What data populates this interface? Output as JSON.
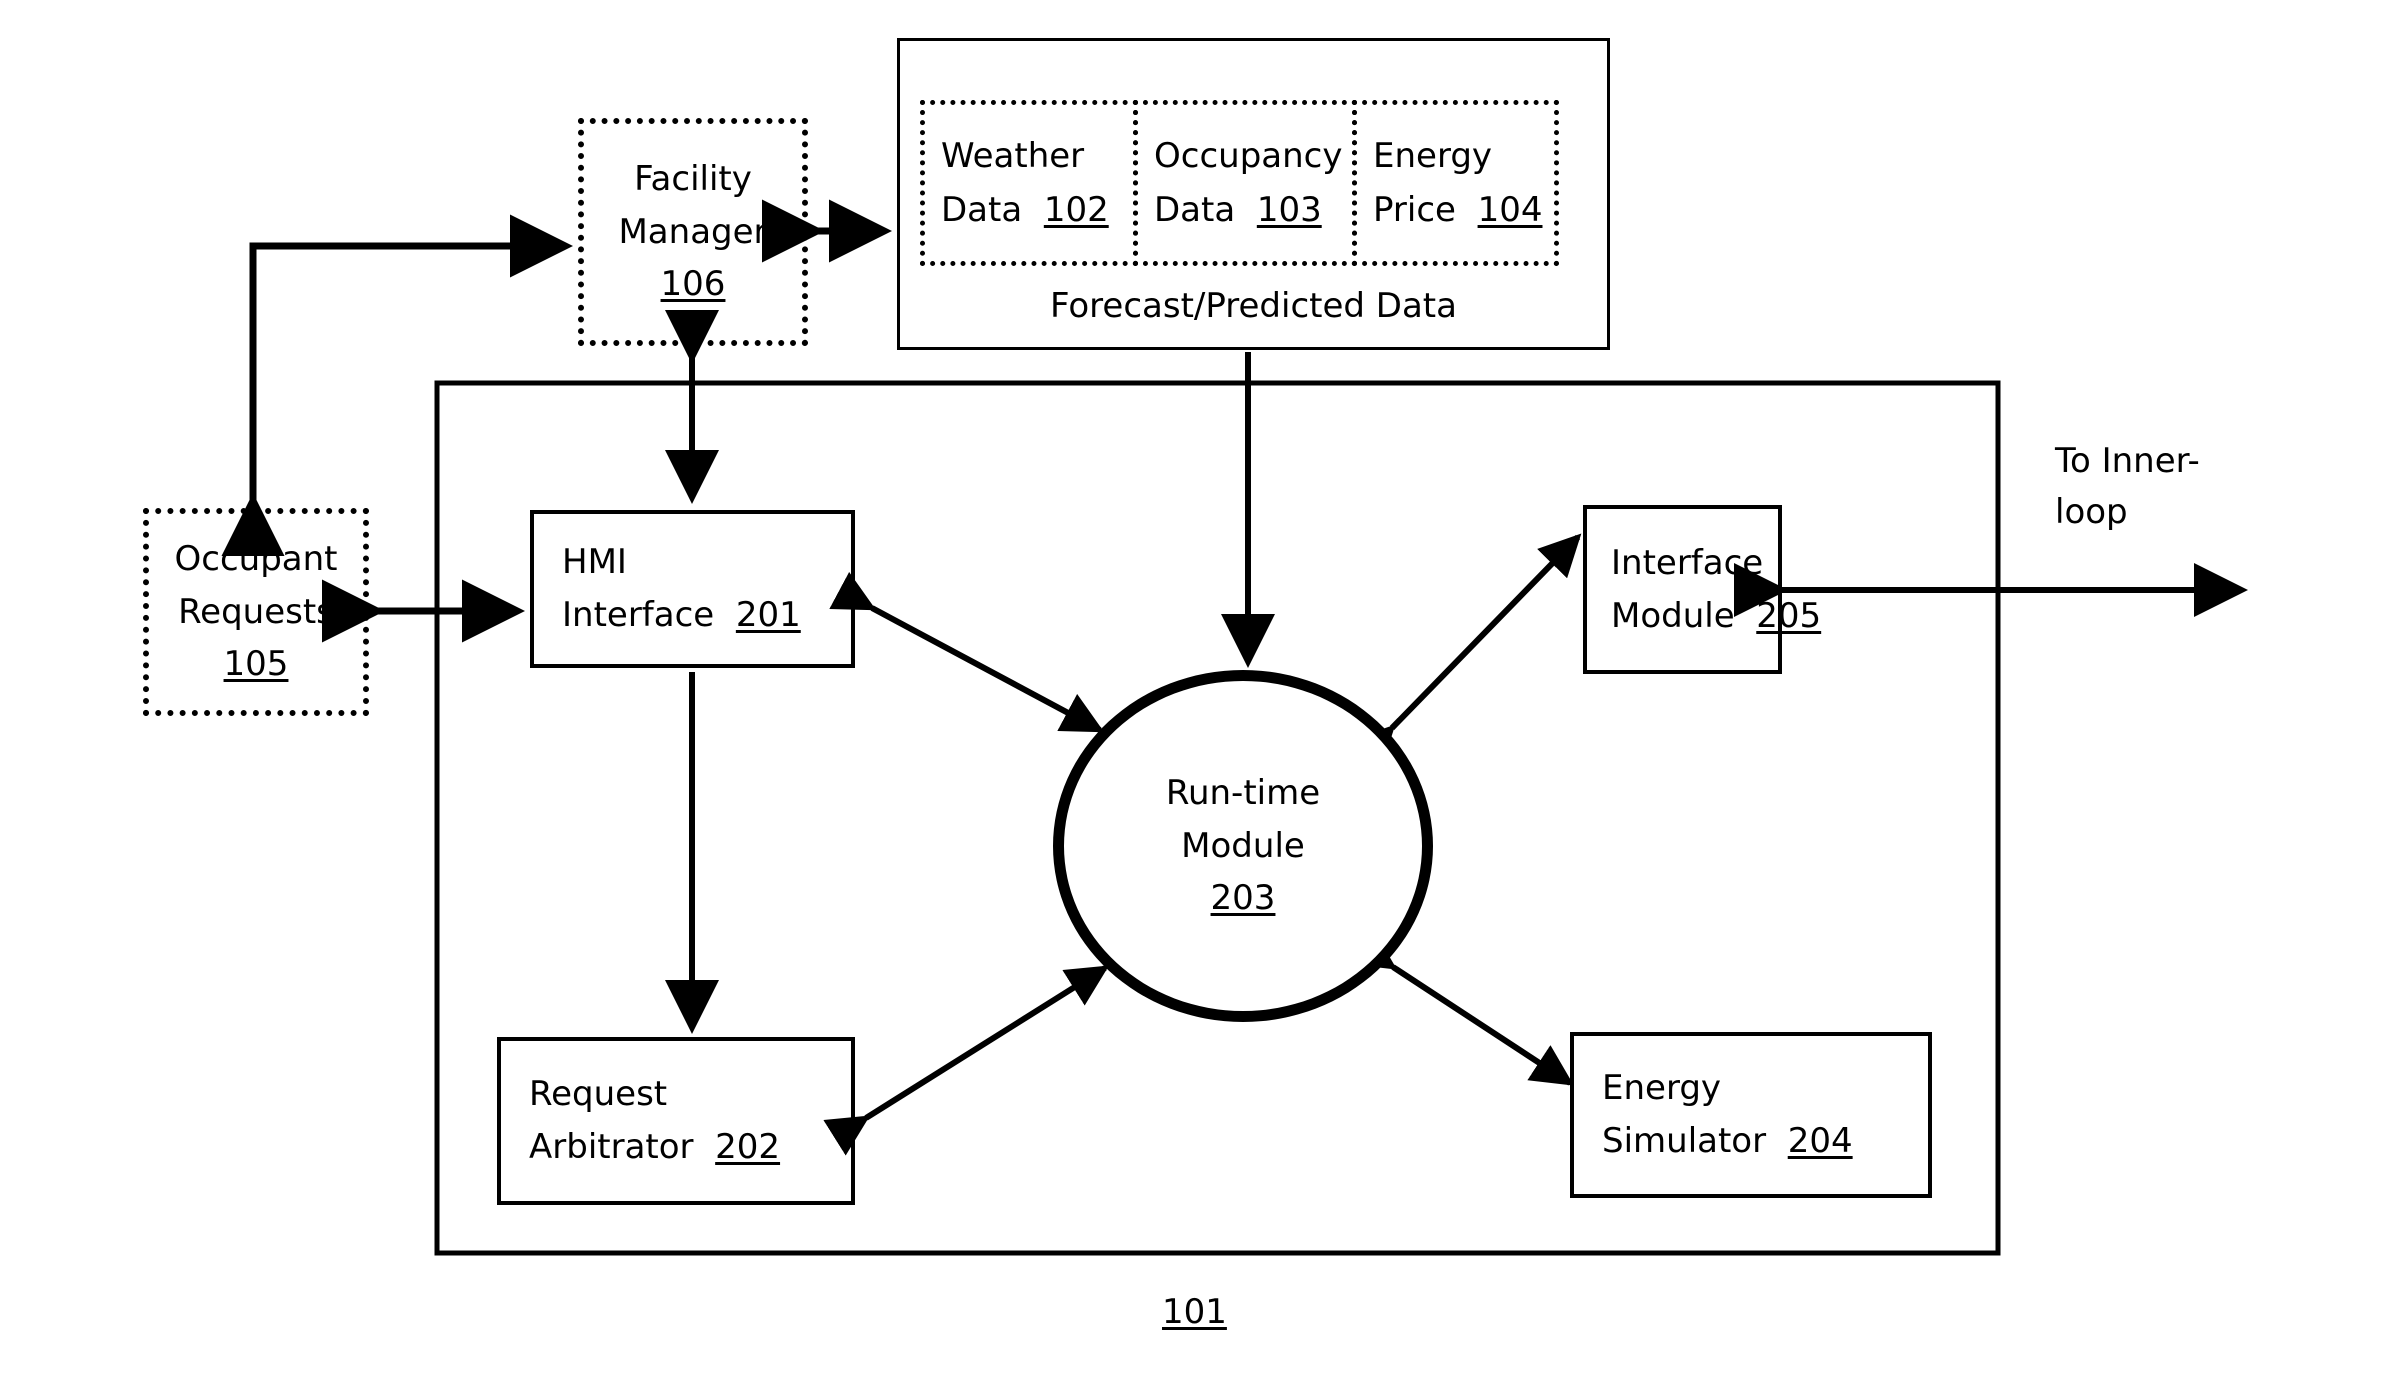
{
  "diagram": {
    "figure_label": "101",
    "outer_container_name": "outer-system-boundary",
    "external_note": "To Inner-loop",
    "forecast_group": {
      "caption": "Forecast/Predicted Data",
      "cells": [
        {
          "line1": "Weather",
          "line2": "Data",
          "ref": "102"
        },
        {
          "line1": "Occupancy",
          "line2": "Data",
          "ref": "103"
        },
        {
          "line1": "Energy",
          "line2": "Price",
          "ref": "104"
        }
      ]
    },
    "nodes": {
      "facility_manager": {
        "line1": "Facility",
        "line2": "Manager",
        "ref": "106"
      },
      "occupant_requests": {
        "line1": "Occupant",
        "line2": "Requests",
        "ref": "105"
      },
      "hmi_interface": {
        "line1": "HMI",
        "line2": "Interface",
        "ref": "201"
      },
      "request_arbitrator": {
        "line1": "Request",
        "line2": "Arbitrator",
        "ref": "202"
      },
      "run_time_module": {
        "line1": "Run-time",
        "line2": "Module",
        "ref": "203"
      },
      "energy_simulator": {
        "line1": "Energy",
        "line2": "Simulator",
        "ref": "204"
      },
      "interface_module": {
        "line1": "Interface",
        "line2": "Module",
        "ref": "205"
      }
    },
    "connections": [
      {
        "name": "occupant-requests-to-facility-manager",
        "from": "occupant_requests",
        "to": "facility_manager",
        "heads": 1
      },
      {
        "name": "facility-manager-to-forecast-data",
        "from": "facility_manager",
        "to": "forecast_group",
        "heads": 2
      },
      {
        "name": "facility-manager-to-hmi-interface",
        "from": "facility_manager",
        "to": "hmi_interface",
        "heads": 2
      },
      {
        "name": "occupant-requests-to-hmi-interface",
        "from": "occupant_requests",
        "to": "hmi_interface",
        "heads": 2
      },
      {
        "name": "forecast-data-to-run-time-module",
        "from": "forecast_group",
        "to": "run_time_module",
        "heads": 1
      },
      {
        "name": "hmi-interface-to-run-time-module",
        "from": "hmi_interface",
        "to": "run_time_module",
        "heads": 2
      },
      {
        "name": "hmi-interface-to-request-arbitrator",
        "from": "hmi_interface",
        "to": "request_arbitrator",
        "heads": 1
      },
      {
        "name": "request-arbitrator-to-run-time-module",
        "from": "request_arbitrator",
        "to": "run_time_module",
        "heads": 2
      },
      {
        "name": "run-time-module-to-energy-simulator",
        "from": "run_time_module",
        "to": "energy_simulator",
        "heads": 2
      },
      {
        "name": "run-time-module-to-interface-module",
        "from": "run_time_module",
        "to": "interface_module",
        "heads": 2
      },
      {
        "name": "interface-module-to-inner-loop",
        "from": "interface_module",
        "to": "inner_loop",
        "heads": 2
      }
    ],
    "colors": {
      "stroke": "#000000",
      "background": "#ffffff"
    }
  }
}
